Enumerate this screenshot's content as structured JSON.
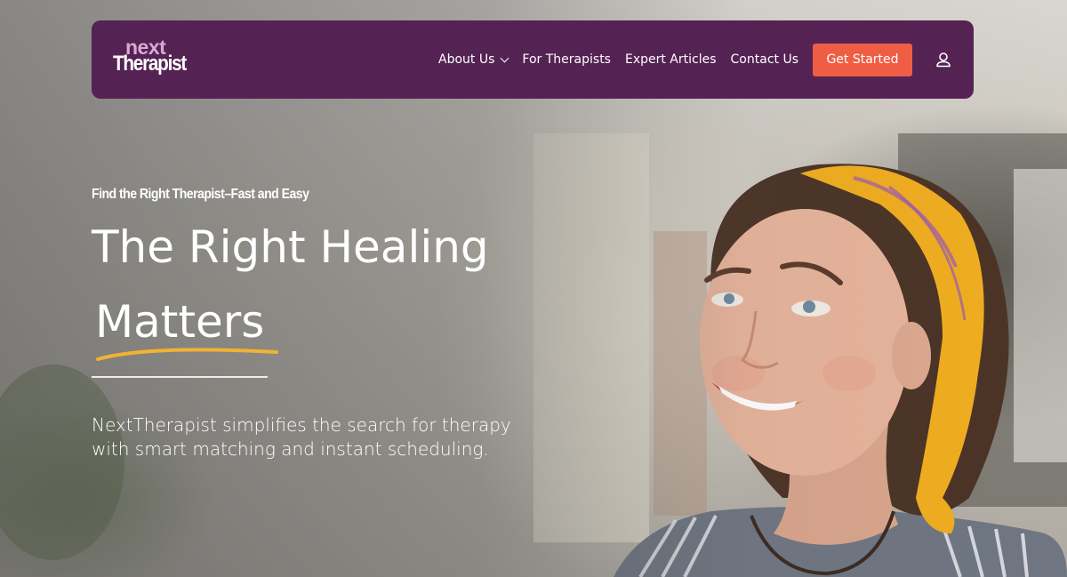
{
  "logo": {
    "line1": "next",
    "line2": "Therapist"
  },
  "nav": {
    "items": [
      {
        "label": "About Us",
        "has_dropdown": true
      },
      {
        "label": "For Therapists"
      },
      {
        "label": "Expert Articles"
      },
      {
        "label": "Contact Us"
      }
    ],
    "cta_label": "Get Started",
    "user_icon": "user-icon"
  },
  "hero": {
    "eyebrow": "Find the Right Therapist–Fast and Easy",
    "headline_line1": "The Right Healing",
    "headline_line2": "Matters",
    "subcopy": "NextTherapist simplifies the search for therapy with smart matching and instant scheduling."
  },
  "colors": {
    "nav_bg": "#552254",
    "cta_bg": "#ef5e44",
    "logo_accent": "#d9a9d1",
    "underline_accent": "#f2b233"
  }
}
